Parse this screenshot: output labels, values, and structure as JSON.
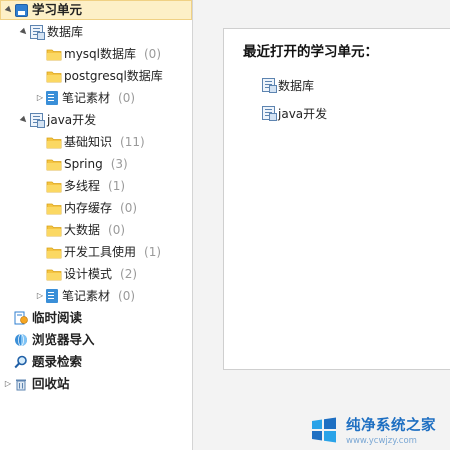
{
  "sidebar": {
    "items": [
      {
        "label": "学习单元",
        "count": "",
        "icon": "study-unit-icon",
        "arrow": "▲",
        "level": 0,
        "selected": true,
        "bold": true
      },
      {
        "label": "数据库",
        "count": "",
        "icon": "database-icon",
        "arrow": "▲",
        "level": 1,
        "selected": false,
        "bold": false
      },
      {
        "label": "mysql数据库",
        "count": "(0)",
        "icon": "folder-icon",
        "arrow": "",
        "level": 2,
        "selected": false,
        "bold": false
      },
      {
        "label": "postgresql数据库",
        "count": "",
        "icon": "folder-icon",
        "arrow": "",
        "level": 2,
        "selected": false,
        "bold": false
      },
      {
        "label": "笔记素材",
        "count": "(0)",
        "icon": "notebook-icon",
        "arrow": "▷",
        "level": 2,
        "selected": false,
        "bold": false
      },
      {
        "label": "java开发",
        "count": "",
        "icon": "database-icon",
        "arrow": "▲",
        "level": 1,
        "selected": false,
        "bold": false
      },
      {
        "label": "基础知识",
        "count": "(11)",
        "icon": "folder-icon",
        "arrow": "",
        "level": 2,
        "selected": false,
        "bold": false
      },
      {
        "label": "Spring",
        "count": "(3)",
        "icon": "folder-icon",
        "arrow": "",
        "level": 2,
        "selected": false,
        "bold": false
      },
      {
        "label": "多线程",
        "count": "(1)",
        "icon": "folder-icon",
        "arrow": "",
        "level": 2,
        "selected": false,
        "bold": false
      },
      {
        "label": "内存缓存",
        "count": "(0)",
        "icon": "folder-icon",
        "arrow": "",
        "level": 2,
        "selected": false,
        "bold": false
      },
      {
        "label": "大数据",
        "count": "(0)",
        "icon": "folder-icon",
        "arrow": "",
        "level": 2,
        "selected": false,
        "bold": false
      },
      {
        "label": "开发工具使用",
        "count": "(1)",
        "icon": "folder-icon",
        "arrow": "",
        "level": 2,
        "selected": false,
        "bold": false
      },
      {
        "label": "设计模式",
        "count": "(2)",
        "icon": "folder-icon",
        "arrow": "",
        "level": 2,
        "selected": false,
        "bold": false
      },
      {
        "label": "笔记素材",
        "count": "(0)",
        "icon": "notebook-icon",
        "arrow": "▷",
        "level": 2,
        "selected": false,
        "bold": false
      },
      {
        "label": "临时阅读",
        "count": "",
        "icon": "reading-icon",
        "arrow": "",
        "level": 0,
        "selected": false,
        "bold": true
      },
      {
        "label": "浏览器导入",
        "count": "",
        "icon": "browser-import-icon",
        "arrow": "",
        "level": 0,
        "selected": false,
        "bold": true
      },
      {
        "label": "题录检索",
        "count": "",
        "icon": "search-icon",
        "arrow": "",
        "level": 0,
        "selected": false,
        "bold": true
      },
      {
        "label": "回收站",
        "count": "",
        "icon": "recycle-bin-icon",
        "arrow": "▷",
        "level": 0,
        "selected": false,
        "bold": true
      }
    ]
  },
  "main": {
    "recent_title": "最近打开的学习单元：",
    "recent_items": [
      {
        "label": "数据库",
        "icon": "database-icon"
      },
      {
        "label": "java开发",
        "icon": "database-icon"
      }
    ]
  },
  "watermark": {
    "main": "纯净系统之家",
    "sub": "www.ycwjzy.com"
  },
  "colors": {
    "selection_bg": "#fdf0c7",
    "folder_yellow": "#f5c542",
    "accent_blue": "#2f7fd1",
    "count_gray": "#9a9a9a"
  }
}
